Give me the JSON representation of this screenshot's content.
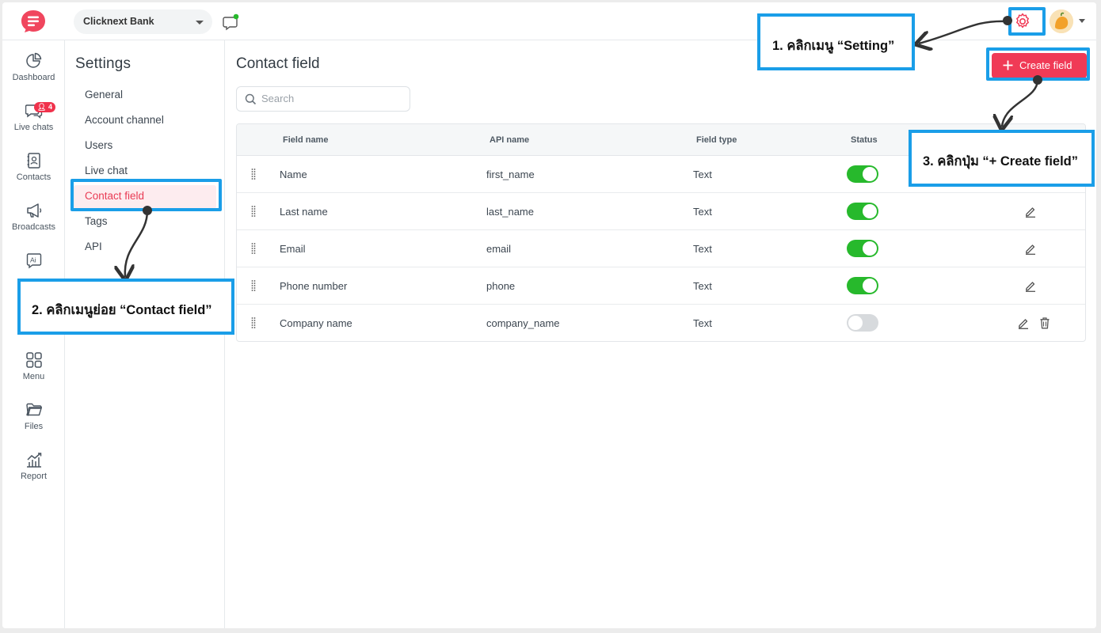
{
  "topbar": {
    "workspace": "Clicknext Bank"
  },
  "rail": {
    "items": [
      {
        "label": "Dashboard",
        "icon": "pie-chart-icon"
      },
      {
        "label": "Live chats",
        "icon": "chat-icon",
        "badge": "4"
      },
      {
        "label": "Contacts",
        "icon": "contacts-icon"
      },
      {
        "label": "Broadcasts",
        "icon": "megaphone-icon"
      },
      {
        "label": "Ai",
        "icon": "ai-icon"
      },
      {
        "label": "Menu",
        "icon": "grid-icon"
      },
      {
        "label": "Files",
        "icon": "folder-icon"
      },
      {
        "label": "Report",
        "icon": "report-icon"
      }
    ]
  },
  "settings": {
    "title": "Settings",
    "items": [
      "General",
      "Account channel",
      "Users",
      "Live chat",
      "Contact field",
      "Tags",
      "API"
    ],
    "active": "Contact field"
  },
  "main": {
    "title": "Contact field",
    "search_placeholder": "Search",
    "create_label": "Create field",
    "columns": [
      "Field name",
      "API name",
      "Field type",
      "Status"
    ],
    "rows": [
      {
        "field": "Name",
        "api": "first_name",
        "type": "Text",
        "enabled": true,
        "editable": false,
        "deletable": false
      },
      {
        "field": "Last name",
        "api": "last_name",
        "type": "Text",
        "enabled": true,
        "editable": true,
        "deletable": false
      },
      {
        "field": "Email",
        "api": "email",
        "type": "Text",
        "enabled": true,
        "editable": true,
        "deletable": false
      },
      {
        "field": "Phone number",
        "api": "phone",
        "type": "Text",
        "enabled": true,
        "editable": true,
        "deletable": false
      },
      {
        "field": "Company name",
        "api": "company_name",
        "type": "Text",
        "enabled": false,
        "editable": true,
        "deletable": true
      }
    ]
  },
  "annotations": {
    "step1": "1. คลิกเมนู “Setting”",
    "step2": "2. คลิกเมนูย่อย “Contact field”",
    "step3": "3. คลิกปุ่ม “+ Create field”"
  },
  "colors": {
    "accent": "#f03a56",
    "toggle_on": "#27b92c",
    "callout_border": "#1a9ee8"
  }
}
